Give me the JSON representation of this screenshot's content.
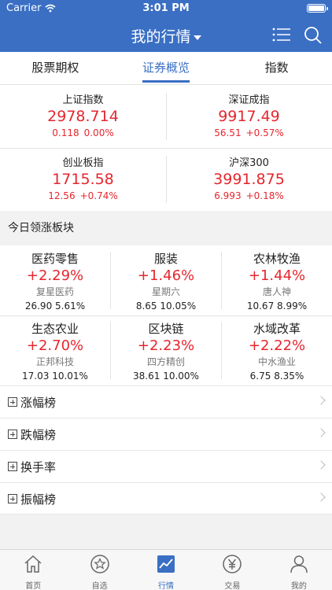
{
  "status_bar": {
    "carrier": "Carrier",
    "time": "3:01 PM"
  },
  "nav": {
    "title": "我的行情"
  },
  "segments": [
    {
      "label": "股票期权"
    },
    {
      "label": "证券概览"
    },
    {
      "label": "指数"
    }
  ],
  "indices": [
    {
      "name": "上证指数",
      "value": "2978.714",
      "change": "0.118",
      "pct": "0.00%"
    },
    {
      "name": "深证成指",
      "value": "9917.49",
      "change": "56.51",
      "pct": "+0.57%"
    },
    {
      "name": "创业板指",
      "value": "1715.58",
      "change": "12.56",
      "pct": "+0.74%"
    },
    {
      "name": "沪深300",
      "value": "3991.875",
      "change": "6.993",
      "pct": "+0.18%"
    }
  ],
  "section": {
    "title": "今日领涨板块"
  },
  "sectors": [
    {
      "name": "医药零售",
      "pct": "+2.29%",
      "stock": "复星医药",
      "price": "26.90",
      "stock_pct": "5.61%"
    },
    {
      "name": "服装",
      "pct": "+1.46%",
      "stock": "星期六",
      "price": "8.65",
      "stock_pct": "10.05%"
    },
    {
      "name": "农林牧渔",
      "pct": "+1.44%",
      "stock": "唐人神",
      "price": "10.67",
      "stock_pct": "8.99%"
    },
    {
      "name": "生态农业",
      "pct": "+2.70%",
      "stock": "正邦科技",
      "price": "17.03",
      "stock_pct": "10.01%"
    },
    {
      "name": "区块链",
      "pct": "+2.23%",
      "stock": "四方精创",
      "price": "38.61",
      "stock_pct": "10.00%"
    },
    {
      "name": "水域改革",
      "pct": "+2.22%",
      "stock": "中水渔业",
      "price": "6.75",
      "stock_pct": "8.35%"
    }
  ],
  "rankings": [
    {
      "label": "涨幅榜"
    },
    {
      "label": "跌幅榜"
    },
    {
      "label": "换手率"
    },
    {
      "label": "振幅榜"
    }
  ],
  "tabbar": [
    {
      "label": "首页",
      "icon": "home-icon"
    },
    {
      "label": "自选",
      "icon": "star-icon"
    },
    {
      "label": "行情",
      "icon": "chart-icon"
    },
    {
      "label": "交易",
      "icon": "yuan-icon"
    },
    {
      "label": "我的",
      "icon": "user-icon"
    }
  ],
  "colors": {
    "brand": "#3a6fc4",
    "up": "#e6262e"
  }
}
